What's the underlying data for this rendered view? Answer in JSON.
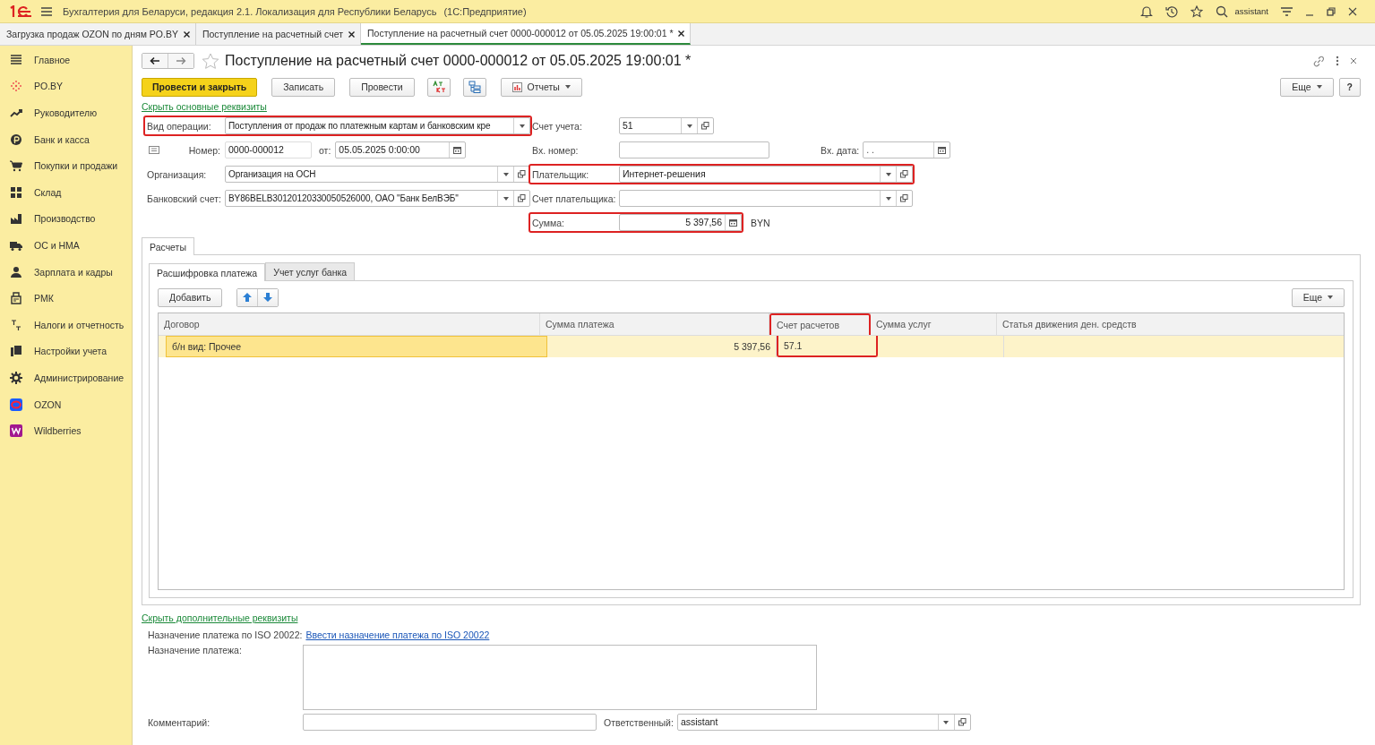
{
  "app_bar": {
    "title": "Бухгалтерия для Беларуси, редакция 2.1. Локализация для Республики Беларусь",
    "platform": "(1С:Предприятие)",
    "user": "assistant"
  },
  "tabs": [
    {
      "label": "Загрузка продаж OZON по дням PO.BY",
      "selected": false
    },
    {
      "label": "Поступление на расчетный счет",
      "selected": false
    },
    {
      "label": "Поступление на расчетный счет 0000-000012 от 05.05.2025 19:00:01 *",
      "selected": true
    }
  ],
  "sidebar": {
    "items": [
      {
        "label": "Главное"
      },
      {
        "label": "PO.BY"
      },
      {
        "label": "Руководителю"
      },
      {
        "label": "Банк и касса"
      },
      {
        "label": "Покупки и продажи"
      },
      {
        "label": "Склад"
      },
      {
        "label": "Производство"
      },
      {
        "label": "ОС и НМА"
      },
      {
        "label": "Зарплата и кадры"
      },
      {
        "label": "РМК"
      },
      {
        "label": "Налоги и отчетность"
      },
      {
        "label": "Настройки учета"
      },
      {
        "label": "Администрирование"
      },
      {
        "label": "OZON"
      },
      {
        "label": "Wildberries"
      }
    ]
  },
  "document": {
    "title": "Поступление на расчетный счет 0000-000012 от 05.05.2025 19:00:01 *",
    "favorite": false,
    "toolbar": {
      "post_close": "Провести и закрыть",
      "save": "Записать",
      "post": "Провести",
      "reports": "Отчеты",
      "more": "Еще",
      "help": "?"
    },
    "main_link": "Скрыть основные реквизиты",
    "fields": {
      "operation": {
        "label": "Вид операции:",
        "value": "Поступления от продаж по платежным картам и банковским кре",
        "highlighted": true
      },
      "account": {
        "label": "Счет учета:",
        "value": "51"
      },
      "number": {
        "label": "Номер:",
        "value": "0000-000012"
      },
      "date": {
        "label": "от:",
        "value": "05.05.2025  0:00:00"
      },
      "in_number": {
        "label": "Вх. номер:"
      },
      "in_date": {
        "label": "Вх. дата:",
        "value": " .  ."
      },
      "organization": {
        "label": "Организация:",
        "value": "Организация на ОСН",
        "highlighted": false
      },
      "payer": {
        "label": "Плательщик:",
        "value": "Интернет-решения",
        "highlighted": true
      },
      "bank_account": {
        "label": "Банковский счет:",
        "value": "BY86BELB30120120330050526000, ОАО \"Банк БелВЭБ\"",
        "highlighted": false
      },
      "payer_account": {
        "label": "Счет плательщика:",
        "highlighted": false
      },
      "sum": {
        "label": "Сумма:",
        "value": "5 397,56",
        "currency": "BYN",
        "highlighted": true
      }
    },
    "outer_tabs": [
      {
        "label": "Расчеты",
        "selected": true
      }
    ],
    "inner_tabs": [
      {
        "label": "Расшифровка платежа",
        "selected": true
      },
      {
        "label": "Учет услуг банка",
        "selected": false
      }
    ],
    "table_toolbar": {
      "add": "Добавить",
      "more": "Еще"
    },
    "table": {
      "columns": [
        {
          "label": "Договор",
          "highlighted": false
        },
        {
          "label": "Сумма платежа",
          "highlighted": false
        },
        {
          "label": "Счет расчетов",
          "highlighted": true
        },
        {
          "label": "Сумма услуг",
          "highlighted": false
        },
        {
          "label": "Статья движения ден. средств",
          "highlighted": false
        }
      ],
      "rows": [
        {
          "cells": [
            "б/н вид: Прочее",
            "5 397,56",
            "57.1",
            null,
            null
          ],
          "selected": true
        }
      ]
    },
    "extra_link": "Скрыть дополнительные реквизиты",
    "iso_label": "Назначение платежа по ISO 20022:",
    "iso_link": "Ввести назначение платежа по ISO 20022",
    "purpose": {
      "label": "Назначение платежа:"
    },
    "comment": {
      "label": "Комментарий:"
    },
    "responsible": {
      "label": "Ответственный:",
      "value": "assistant"
    }
  }
}
